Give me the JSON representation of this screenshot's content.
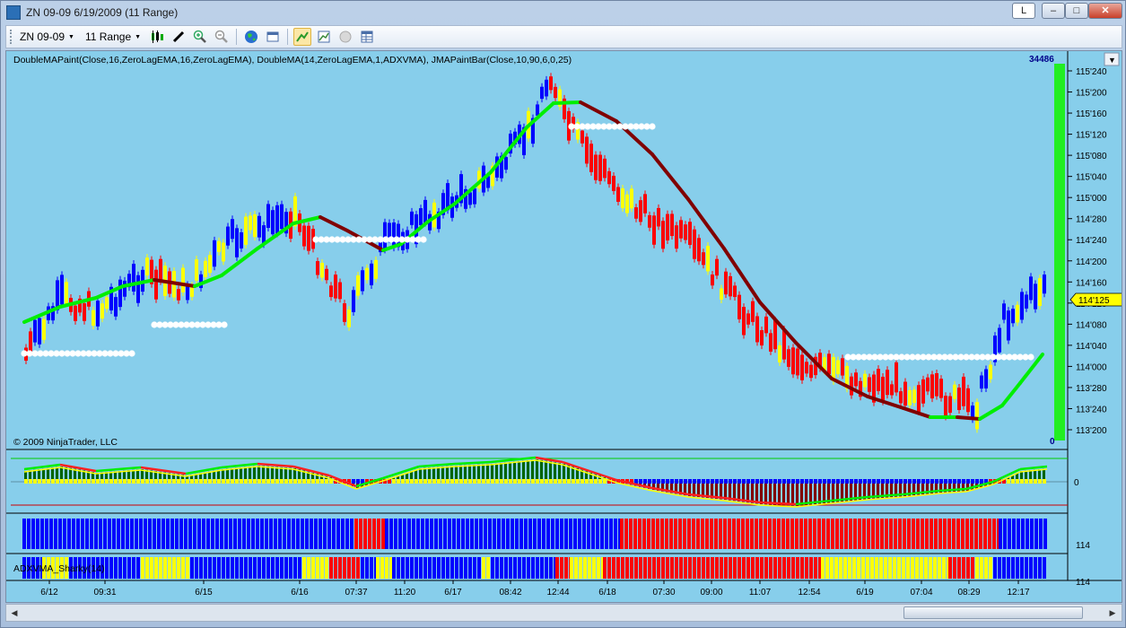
{
  "window": {
    "title": "ZN 09-09  6/19/2009 (11 Range)",
    "controls": {
      "l_label": "L",
      "minimize": "–",
      "maximize": "□",
      "close": "✕"
    }
  },
  "toolbar": {
    "instrument": "ZN 09-09",
    "period": "11 Range",
    "buttons": [
      "candlestick-icon",
      "pencil-icon",
      "zoom-in-icon",
      "zoom-out-icon",
      "globe-icon",
      "window-icon",
      "strategy-icon",
      "chart-icon",
      "circle-icon",
      "table-icon"
    ]
  },
  "chart": {
    "indicator_label": "DoubleMAPaint(Close,16,ZeroLagEMA,16,ZeroLagEMA), DoubleMA(14,ZeroLagEMA,1,ADXVMA), JMAPaintBar(Close,10,90,6,0,25)",
    "copyright": "© 2009 NinjaTrader, LLC",
    "right_counter": "34486",
    "volume_zero": "0",
    "current_price": "114'125",
    "price_ticks": [
      "115'240",
      "115'200",
      "115'160",
      "115'120",
      "115'080",
      "115'040",
      "115'000",
      "114'280",
      "114'240",
      "114'200",
      "114'160",
      "114'120",
      "114'080",
      "114'040",
      "114'000",
      "113'280",
      "113'240",
      "113'200"
    ],
    "osc_zero": "0",
    "panel3_label": "114",
    "panel4_label": "ADXVMA_Sharky(14)",
    "panel4_value": "114",
    "time_labels": [
      "6/12",
      "09:31",
      "6/15",
      "6/16",
      "07:37",
      "11:20",
      "6/17",
      "08:42",
      "12:44",
      "6/18",
      "07:30",
      "09:00",
      "11:07",
      "12:54",
      "6/19",
      "07:04",
      "08:29",
      "12:17"
    ],
    "colors": {
      "background": "#87ceeb",
      "up_bar": "#0000ff",
      "down_bar": "#ff0000",
      "neutral_bar": "#ffff00",
      "ma_up": "#00ee00",
      "ma_down": "#800000"
    }
  },
  "chart_data": {
    "type": "line",
    "title": "",
    "xlabel": "",
    "ylabel": "",
    "ylim": [
      "113'190",
      "115'250"
    ],
    "series": [],
    "categories": [
      "6/12",
      "09:31",
      "6/15",
      "6/16",
      "07:37",
      "11:20",
      "6/17",
      "08:42",
      "12:44",
      "6/18",
      "07:30",
      "09:00",
      "11:07",
      "12:54",
      "6/19",
      "07:04",
      "08:29",
      "12:17"
    ]
  },
  "scrollbar": {
    "left_arrow": "◀",
    "right_arrow": "▶"
  }
}
